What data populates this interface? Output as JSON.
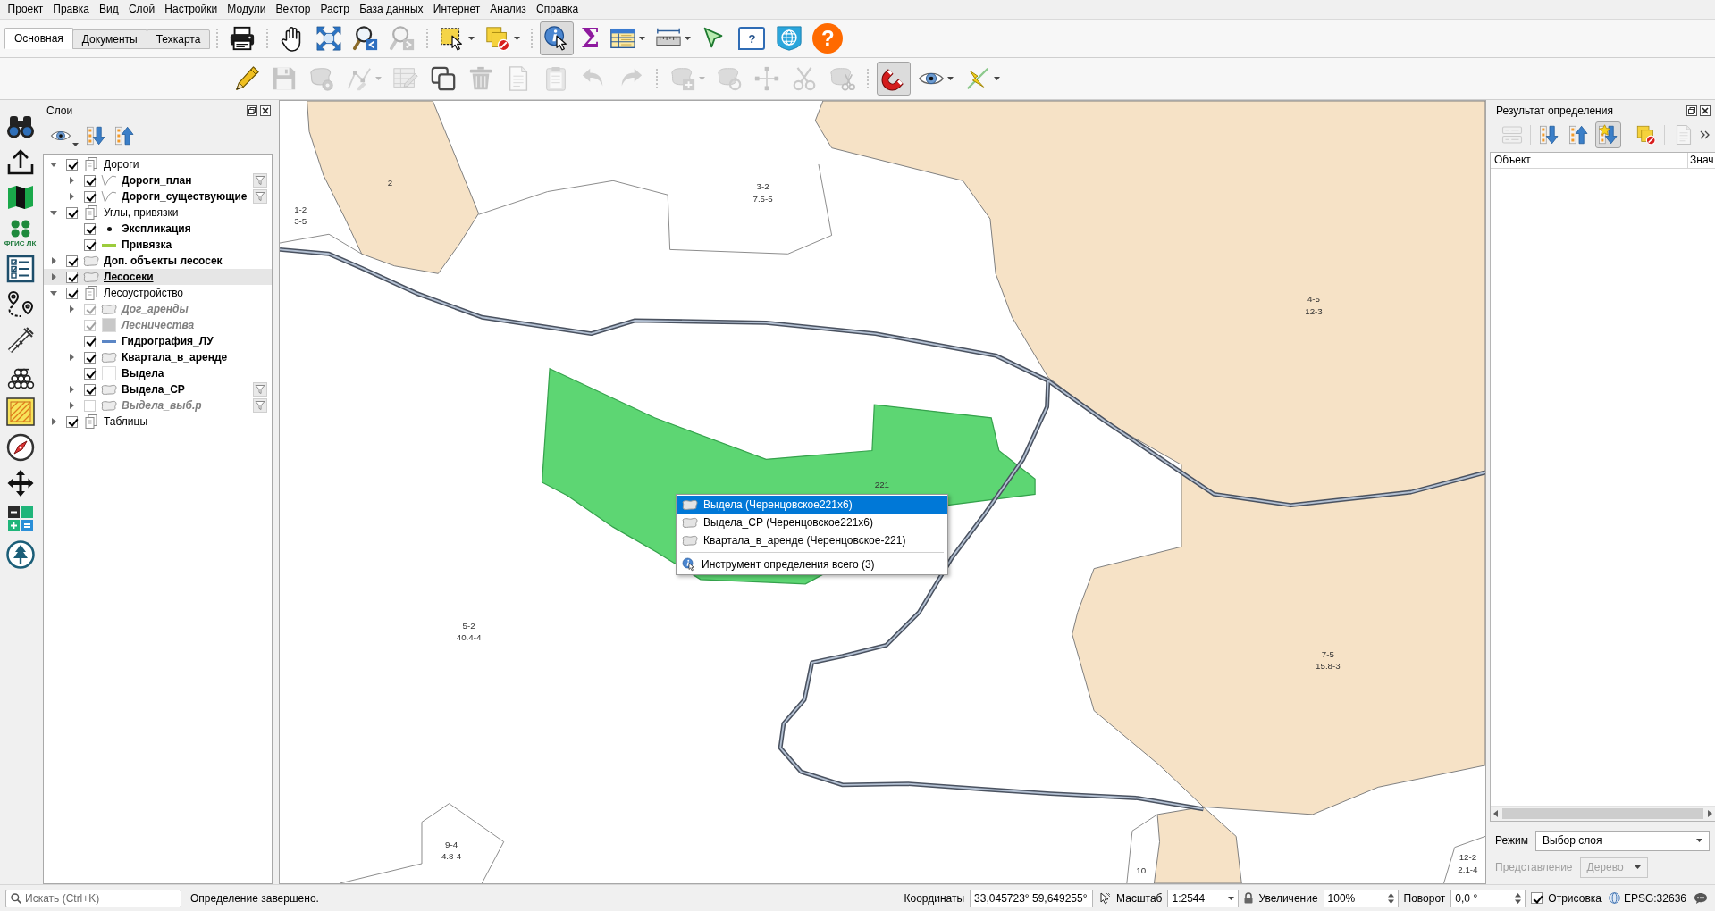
{
  "menu_bar": {
    "items": [
      "Проект",
      "Правка",
      "Вид",
      "Слой",
      "Настройки",
      "Модули",
      "Вектор",
      "Растр",
      "База данных",
      "Интернет",
      "Анализ",
      "Справка"
    ]
  },
  "ribbon": {
    "tabs": [
      {
        "label": "Основная",
        "selected": true
      },
      {
        "label": "Документы",
        "selected": false
      },
      {
        "label": "Техкарта",
        "selected": false
      }
    ],
    "tools": [
      {
        "pressed": false,
        "disabled": false
      },
      {
        "pressed": false,
        "disabled": false
      },
      {
        "pressed": false,
        "disabled": false
      },
      {
        "pressed": false,
        "disabled": false
      },
      {
        "pressed": false,
        "disabled": true
      },
      {
        "pressed": false,
        "disabled": false
      },
      {
        "pressed": false,
        "disabled": false
      },
      {
        "pressed": true,
        "disabled": false
      },
      {
        "pressed": false,
        "disabled": false,
        "label": "Σ"
      },
      {
        "pressed": false,
        "disabled": false
      },
      {
        "pressed": false,
        "disabled": false
      },
      {
        "pressed": false,
        "disabled": false
      },
      {
        "pressed": false,
        "disabled": false,
        "label": "?"
      },
      {
        "pressed": false,
        "disabled": false
      },
      {
        "pressed": false,
        "disabled": false,
        "label": "?"
      }
    ]
  },
  "edit_toolbar": {
    "tools": [
      {
        "pressed": false,
        "disabled": false
      },
      {
        "pressed": false,
        "disabled": true
      },
      {
        "pressed": false,
        "disabled": true
      },
      {
        "pressed": false,
        "disabled": true
      },
      {
        "pressed": false,
        "disabled": true
      },
      {
        "pressed": false,
        "disabled": false
      },
      {
        "pressed": false,
        "disabled": true
      },
      {
        "pressed": false,
        "disabled": true
      },
      {
        "pressed": false,
        "disabled": true
      },
      {
        "pressed": false,
        "disabled": true
      },
      {
        "pressed": false,
        "disabled": true
      },
      {
        "pressed": false,
        "disabled": true
      },
      {
        "pressed": false,
        "disabled": true
      },
      {
        "pressed": false,
        "disabled": true
      },
      {
        "pressed": false,
        "disabled": true
      },
      {
        "pressed": false,
        "disabled": true
      },
      {
        "pressed": true,
        "disabled": false
      },
      {
        "pressed": false,
        "disabled": false
      },
      {
        "pressed": false,
        "disabled": false
      }
    ]
  },
  "side_toolbar": {
    "logo_label": "ФГИС ЛК"
  },
  "layers_panel": {
    "title": "Слои",
    "tree": [
      {
        "name": "Дороги",
        "kind": "group",
        "checked": true,
        "expanded": true,
        "selected": false,
        "children": [
          {
            "name": "Дороги_план",
            "kind": "polyline",
            "checked": true,
            "expanded": false,
            "selected": false,
            "filtered": true
          },
          {
            "name": "Дороги_существующие",
            "kind": "polyline",
            "checked": true,
            "expanded": false,
            "selected": false,
            "filtered": true
          }
        ]
      },
      {
        "name": "Углы, привязки",
        "kind": "group",
        "checked": true,
        "expanded": true,
        "selected": false,
        "children": [
          {
            "name": "Экспликация",
            "kind": "point",
            "checked": true,
            "selected": false
          },
          {
            "name": "Привязка",
            "kind": "line",
            "checked": true,
            "selected": false,
            "color": "#9ccc3c"
          }
        ]
      },
      {
        "name": "Доп. объекты лесосек",
        "kind": "polygon",
        "checked": true,
        "expanded": false,
        "selected": false
      },
      {
        "name": "Лесосеки",
        "kind": "polygon",
        "checked": true,
        "expanded": false,
        "selected": true
      },
      {
        "name": "Лесоустройство",
        "kind": "group",
        "checked": true,
        "expanded": true,
        "selected": false,
        "children": [
          {
            "name": "Дог_аренды",
            "kind": "polygon",
            "checked": true,
            "expanded": false,
            "selected": false,
            "disabled": true
          },
          {
            "name": "Лесничества",
            "kind": "fill",
            "checked": true,
            "selected": false,
            "disabled": true,
            "color": "#c8c8c8"
          },
          {
            "name": "Гидрография_ЛУ",
            "kind": "line",
            "checked": true,
            "selected": false,
            "color": "#5b86c5"
          },
          {
            "name": "Квартала_в_аренде",
            "kind": "polygon",
            "checked": true,
            "expanded": false,
            "selected": false
          },
          {
            "name": "Выдела",
            "kind": "fill",
            "checked": true,
            "selected": false,
            "color": "#ffffff"
          },
          {
            "name": "Выдела_СР",
            "kind": "polygon",
            "checked": true,
            "expanded": false,
            "selected": false,
            "filtered": true
          },
          {
            "name": "Выдела_выб.р",
            "kind": "polygon",
            "checked": false,
            "expanded": false,
            "selected": false,
            "disabled": true,
            "filtered": true
          }
        ]
      },
      {
        "name": "Таблицы",
        "kind": "group",
        "checked": true,
        "expanded": false,
        "selected": false
      }
    ]
  },
  "map": {
    "labels": [
      {
        "title": "2"
      },
      {
        "title": "3-2",
        "subtitle": "7.5-5"
      },
      {
        "title": "1-2",
        "subtitle": "3-5"
      },
      {
        "title": "4-5",
        "subtitle": "12-3"
      },
      {
        "title": "221"
      },
      {
        "title": "5-2",
        "subtitle": "40.4-4"
      },
      {
        "title": "7-5",
        "subtitle": "15.8-3"
      },
      {
        "title": "9-4",
        "subtitle": "4.8-4"
      },
      {
        "title": "12-2",
        "subtitle": "2.1-4"
      },
      {
        "title": "10"
      }
    ],
    "context_menu": {
      "items": [
        {
          "label": "Выдела (Черенцовское221x6)",
          "kind": "layer",
          "selected": true
        },
        {
          "label": "Выдела_СР (Черенцовское221x6)",
          "kind": "layer",
          "selected": false
        },
        {
          "label": "Квартала_в_аренде (Черенцовское-221)",
          "kind": "layer",
          "selected": false
        },
        {
          "label": "Инструмент определения всего (3)",
          "kind": "identify_all",
          "selected": false
        }
      ]
    }
  },
  "identify_panel": {
    "title": "Результат определения",
    "tools": [
      {
        "pressed": false,
        "disabled": true
      },
      {
        "pressed": false,
        "disabled": false
      },
      {
        "pressed": false,
        "disabled": false
      },
      {
        "pressed": true,
        "disabled": false
      },
      {
        "pressed": false,
        "disabled": false
      },
      {
        "pressed": false,
        "disabled": true
      }
    ],
    "columns": [
      "Объект",
      "Знач"
    ],
    "mode": {
      "label": "Режим",
      "value": "Выбор слоя"
    },
    "view": {
      "label": "Представление",
      "value": "Дерево",
      "disabled": true
    }
  },
  "status_bar": {
    "search": {
      "placeholder": "Искать (Ctrl+K)"
    },
    "message": "Определение завершено.",
    "coordinates": {
      "label": "Координаты",
      "value": "33,045723° 59,649255°"
    },
    "scale": {
      "label": "Масштаб",
      "value": "1:2544"
    },
    "magnification": {
      "label": "Увеличение",
      "value": "100%"
    },
    "rotation": {
      "label": "Поворот",
      "value": "0,0 °"
    },
    "render": {
      "label": "Отрисовка",
      "checked": true
    },
    "crs": "EPSG:32636"
  }
}
